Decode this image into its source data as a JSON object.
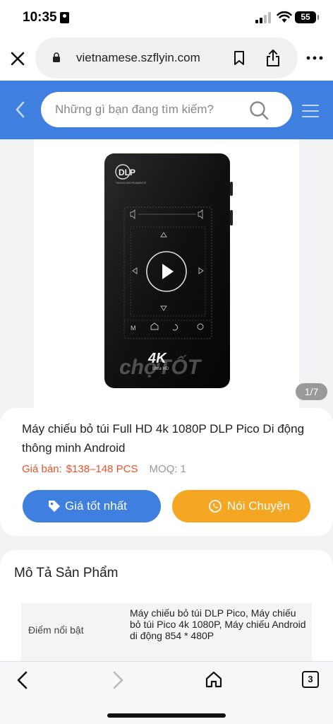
{
  "status_bar": {
    "time": "10:35",
    "battery": "55"
  },
  "browser": {
    "url": "vietnamese.szflyin.com",
    "tab_count": "3"
  },
  "site_header": {
    "search_placeholder": "Những gì bạn đang tìm kiếm?",
    "accent_color": "#3e7fe0"
  },
  "product_image": {
    "counter": "1/7",
    "device_brand": "DLP",
    "device_sub": "TEXAS INSTRUMENTS",
    "badge": "4K",
    "badge_sub": "Ultra HD",
    "control_labels": [
      "M"
    ],
    "watermark": "chợTỐT"
  },
  "product": {
    "title": "Máy chiếu bỏ túi Full HD 4k 1080P DLP Pico Di động thông minh Android",
    "price_label": "Giá bán:",
    "price_value": "$138–148 PCS",
    "moq_label": "MOQ:",
    "moq_value": "1",
    "price_color": "#e8542b"
  },
  "buttons": {
    "best_price": "Giá tốt nhất",
    "chat": "Nói Chuyện",
    "best_price_color": "#3e7fe0",
    "chat_color": "#f5a623"
  },
  "description": {
    "title": "Mô Tả Sản Phẩm",
    "rows": [
      {
        "key": "Điểm nổi bật",
        "value": "Máy chiếu bỏ túi DLP Pico, Máy chiếu bỏ túi Pico 4k 1080P, Máy chiếu Android di động 854 * 480P"
      }
    ]
  },
  "icons": [
    "close-icon",
    "lock-icon",
    "bookmark-icon",
    "share-icon",
    "more-icon",
    "back-chevron-icon",
    "search-icon",
    "hamburger-menu-icon",
    "price-tag-icon",
    "whatsapp-icon",
    "back-icon",
    "forward-icon",
    "home-icon",
    "tabs-icon"
  ]
}
